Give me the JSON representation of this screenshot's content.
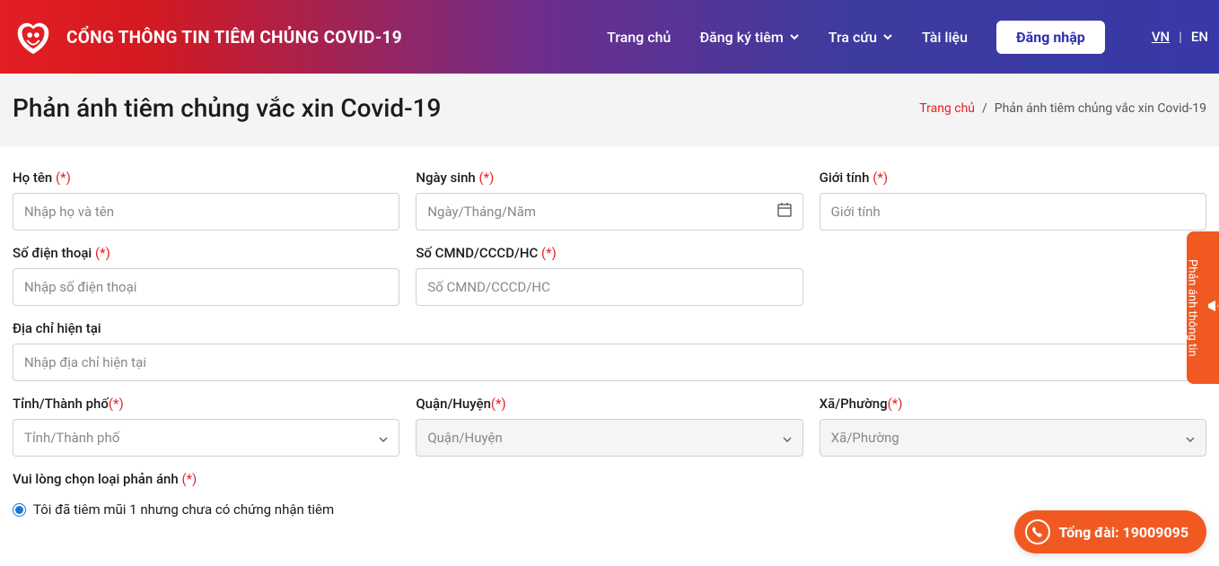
{
  "header": {
    "brand": "CỔNG THÔNG TIN TIÊM CHỦNG COVID-19",
    "nav": {
      "home": "Trang chủ",
      "register": "Đăng ký tiêm",
      "lookup": "Tra cứu",
      "docs": "Tài liệu"
    },
    "login": "Đăng nhập",
    "lang_vn": "VN",
    "lang_en": "EN"
  },
  "titlebar": {
    "title": "Phản ánh tiêm chủng vắc xin Covid-19",
    "crumb_home": "Trang chủ",
    "crumb_sep": "/",
    "crumb_current": "Phản ánh tiêm chủng vắc xin Covid-19"
  },
  "form": {
    "fullname": {
      "label": "Họ tên ",
      "req": "(*)",
      "placeholder": "Nhập họ và tên"
    },
    "dob": {
      "label": "Ngày sinh ",
      "req": "(*)",
      "placeholder": "Ngày/Tháng/Năm"
    },
    "gender": {
      "label": "Giới tính ",
      "req": "(*)",
      "placeholder": "Giới tính"
    },
    "phone": {
      "label": "Số điện thoại ",
      "req": "(*)",
      "placeholder": "Nhập số điện thoại"
    },
    "idnum": {
      "label": "Số CMND/CCCD/HC ",
      "req": "(*)",
      "placeholder": "Số CMND/CCCD/HC"
    },
    "address": {
      "label": "Địa chỉ hiện tại",
      "placeholder": "Nhập địa chỉ hiện tại"
    },
    "province": {
      "label": "Tỉnh/Thành phố",
      "req": "(*)",
      "placeholder": "Tỉnh/Thành phố"
    },
    "district": {
      "label": "Quận/Huyện",
      "req": "(*)",
      "placeholder": "Quận/Huyện"
    },
    "ward": {
      "label": "Xã/Phường",
      "req": "(*)",
      "placeholder": "Xã/Phường"
    },
    "reflect_type": {
      "label": "Vui lòng chọn loại phản ánh ",
      "req": "(*)"
    },
    "option1": "Tôi đã tiêm mũi 1 nhưng chưa có chứng nhận tiêm"
  },
  "side_tab": "Phản ánh thông tin",
  "hotline": {
    "label": "Tổng đài: ",
    "number": "19009095"
  }
}
